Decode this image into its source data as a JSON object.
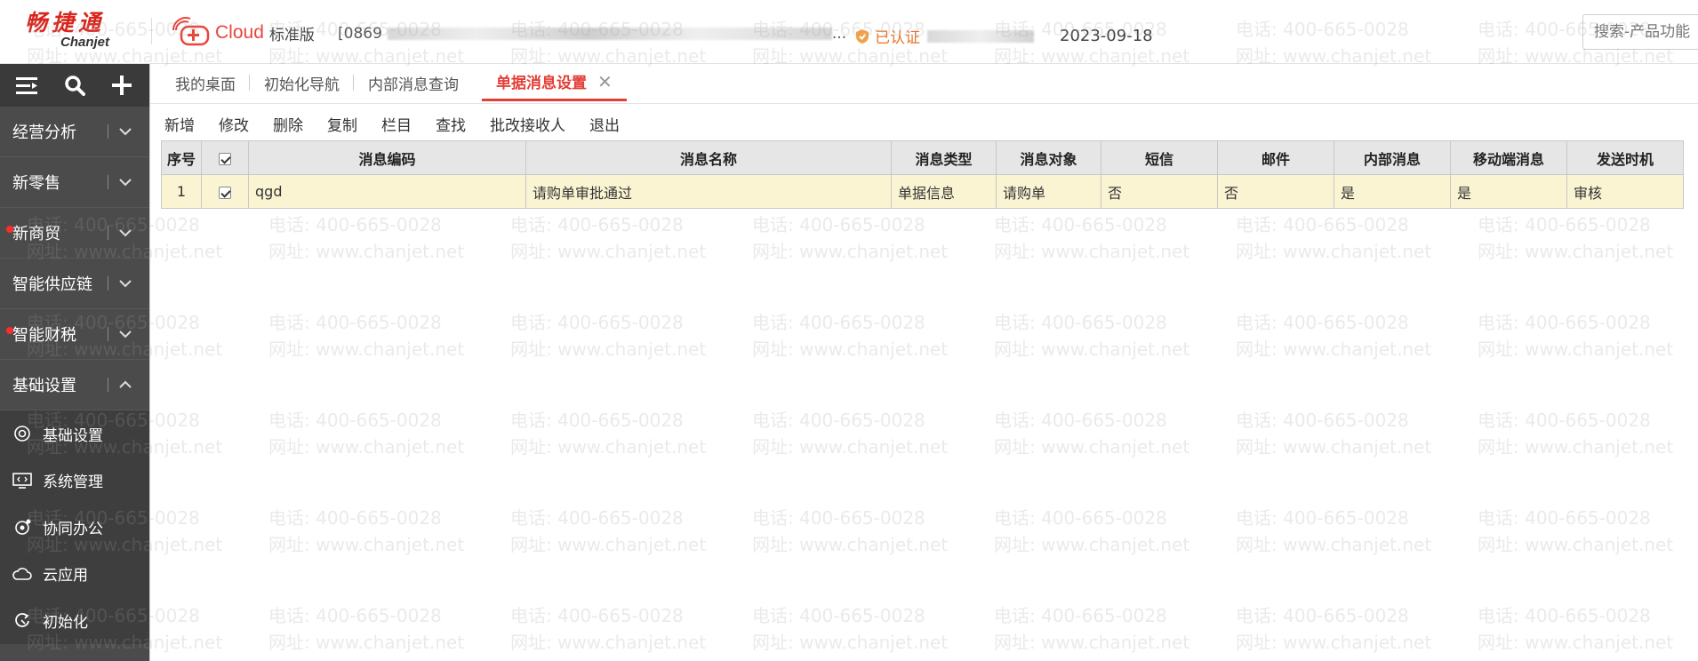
{
  "header": {
    "brand_cn": "畅捷通",
    "brand_en": "Chanjet",
    "cloud_label": "Cloud",
    "edition": "标准版",
    "account_prefix": "[0869",
    "account_suffix": "...",
    "verified": "已认证",
    "date": "2023-09-18",
    "search_placeholder": "搜索-产品功能"
  },
  "sidebar": {
    "groups": [
      {
        "label": "经营分析",
        "dot": false,
        "expanded": false
      },
      {
        "label": "新零售",
        "dot": false,
        "expanded": false
      },
      {
        "label": "新商贸",
        "dot": true,
        "expanded": false
      },
      {
        "label": "智能供应链",
        "dot": false,
        "expanded": false
      },
      {
        "label": "智能财税",
        "dot": true,
        "expanded": false
      },
      {
        "label": "基础设置",
        "dot": false,
        "expanded": true
      }
    ],
    "subitems": [
      {
        "label": "基础设置",
        "icon": "settings-icon"
      },
      {
        "label": "系统管理",
        "icon": "monitor-code-icon"
      },
      {
        "label": "协同办公",
        "icon": "collaboration-icon"
      },
      {
        "label": "云应用",
        "icon": "cloud-icon"
      },
      {
        "label": "初始化",
        "icon": "init-icon"
      }
    ]
  },
  "tabs": [
    {
      "label": "我的桌面",
      "active": false
    },
    {
      "label": "初始化导航",
      "active": false
    },
    {
      "label": "内部消息查询",
      "active": false
    },
    {
      "label": "单据消息设置",
      "active": true
    }
  ],
  "toolbar": [
    "新增",
    "修改",
    "删除",
    "复制",
    "栏目",
    "查找",
    "批改接收人",
    "退出"
  ],
  "table": {
    "headers": [
      "序号",
      "",
      "消息编码",
      "消息名称",
      "消息类型",
      "消息对象",
      "短信",
      "邮件",
      "内部消息",
      "移动端消息",
      "发送时机"
    ],
    "rows": [
      {
        "index": "1",
        "checked": true,
        "code": "qgd",
        "name": "请购单审批通过",
        "type": "单据信息",
        "object": "请购单",
        "sms": "否",
        "email": "否",
        "internal": "是",
        "mobile": "是",
        "timing": "审核"
      }
    ]
  },
  "watermark": {
    "phone": "电话: 400-665-0028",
    "site": "网址: www.chanjet.net"
  },
  "colors": {
    "accent": "#e43e36",
    "sidebar": "#4b4b4b",
    "row_highlight": "#fbf4d3"
  }
}
